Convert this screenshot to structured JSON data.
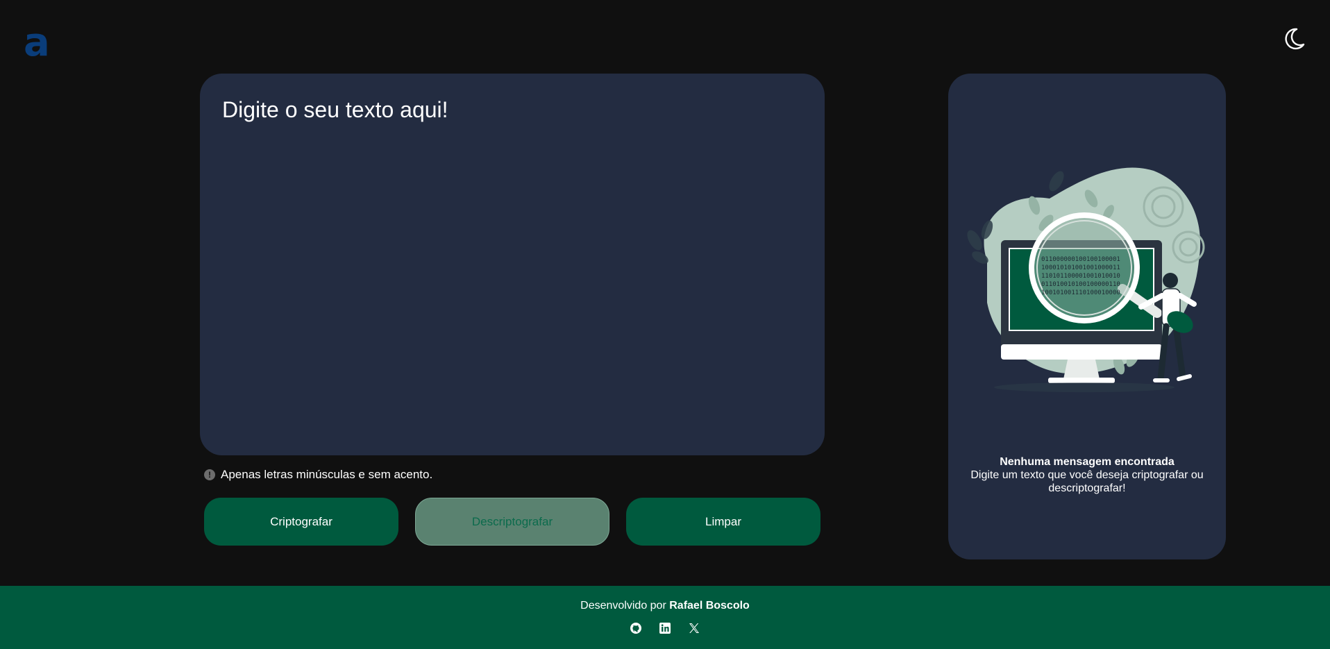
{
  "header": {
    "logo_letter": "a",
    "theme_toggle_icon": "moon-icon"
  },
  "input": {
    "placeholder": "Digite o seu texto aqui!",
    "value": ""
  },
  "hint": {
    "icon": "info-icon",
    "text": "Apenas letras minúsculas e sem acento."
  },
  "buttons": {
    "encrypt": "Criptografar",
    "decrypt": "Descriptografar",
    "clear": "Limpar"
  },
  "output": {
    "illustration": "magnifying-glass-computer-illustration",
    "title": "Nenhuma mensagem encontrada",
    "description": "Digite um texto que você deseja criptografar ou descriptografar!"
  },
  "footer": {
    "developed_by": "Desenvolvido por",
    "author": "Rafael Boscolo",
    "socials": [
      "github-icon",
      "linkedin-icon",
      "x-icon"
    ]
  },
  "colors": {
    "background": "#101010",
    "card": "#232c41",
    "accent": "#005a3e",
    "accent_muted": "#5a8270",
    "logo": "#0a3d7a"
  }
}
